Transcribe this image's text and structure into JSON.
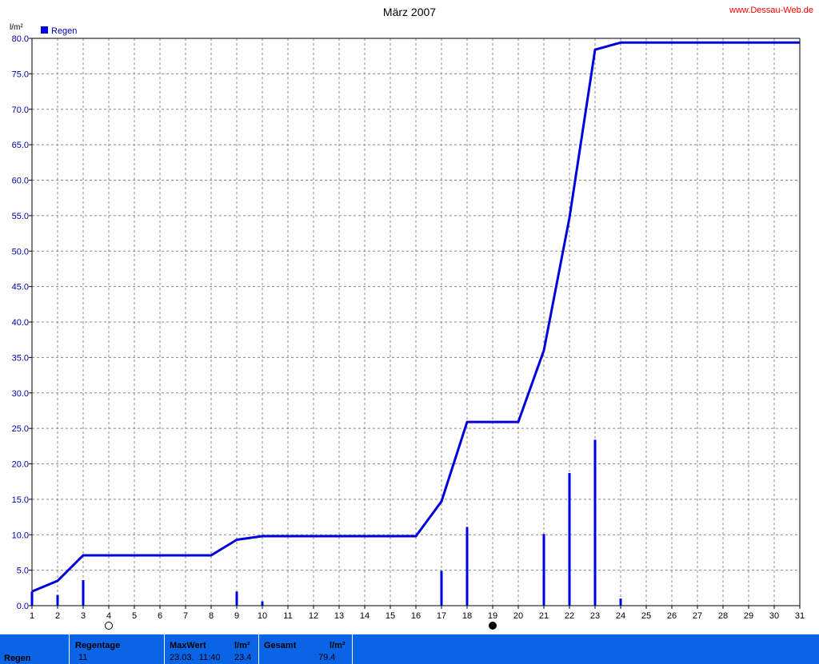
{
  "header": {
    "title": "März 2007",
    "site": "www.Dessau-Web.de",
    "unit_label": "l/m²",
    "legend_label": "Regen"
  },
  "colors": {
    "series": "#0000dd",
    "tick_text": "#0000aa",
    "site_link": "#ff0000",
    "grid": "#888888",
    "stats_bg": "#0a64e6"
  },
  "chart_data": {
    "type": "bar",
    "title": "März 2007",
    "ylabel": "l/m²",
    "xlabel": "",
    "ylim": [
      0,
      80
    ],
    "xlim": [
      1,
      31
    ],
    "grid": true,
    "legend_position": "top-left",
    "y_ticks": [
      "0.0",
      "5.0",
      "10.0",
      "15.0",
      "20.0",
      "25.0",
      "30.0",
      "35.0",
      "40.0",
      "45.0",
      "50.0",
      "55.0",
      "60.0",
      "65.0",
      "70.0",
      "75.0",
      "80.0"
    ],
    "x_ticks": [
      "1",
      "2",
      "3",
      "4",
      "5",
      "6",
      "7",
      "8",
      "9",
      "10",
      "11",
      "12",
      "13",
      "14",
      "15",
      "16",
      "17",
      "18",
      "19",
      "20",
      "21",
      "22",
      "23",
      "24",
      "25",
      "26",
      "27",
      "28",
      "29",
      "30",
      "31"
    ],
    "series": [
      {
        "name": "Regen",
        "type": "bar",
        "x": [
          1,
          2,
          3,
          9,
          10,
          17,
          18,
          21,
          22,
          23,
          24
        ],
        "values": [
          2.0,
          1.5,
          3.6,
          2.0,
          0.6,
          4.9,
          11.1,
          10.1,
          18.7,
          23.4,
          1.0
        ]
      },
      {
        "type": "line",
        "x": [
          1,
          2,
          3,
          8,
          9,
          10,
          16,
          17,
          18,
          20,
          21,
          22,
          23,
          24,
          31
        ],
        "values": [
          2.0,
          3.5,
          7.1,
          7.1,
          9.3,
          9.8,
          9.8,
          14.7,
          25.9,
          25.9,
          36.0,
          54.7,
          78.4,
          79.4,
          79.4
        ]
      }
    ],
    "moon_phases": [
      {
        "day": 4,
        "phase": "full"
      },
      {
        "day": 19,
        "phase": "new"
      }
    ]
  },
  "stats": {
    "row_label": "Regen",
    "regentage_label": "Regentage",
    "regentage_value": "11",
    "maxwert_label": "MaxWert",
    "maxwert_unit": "l/m²",
    "maxwert_date": "23.03.  11:40",
    "maxwert_value": "23.4",
    "gesamt_label": "Gesamt",
    "gesamt_unit": "l/m²",
    "gesamt_value": "79.4"
  }
}
